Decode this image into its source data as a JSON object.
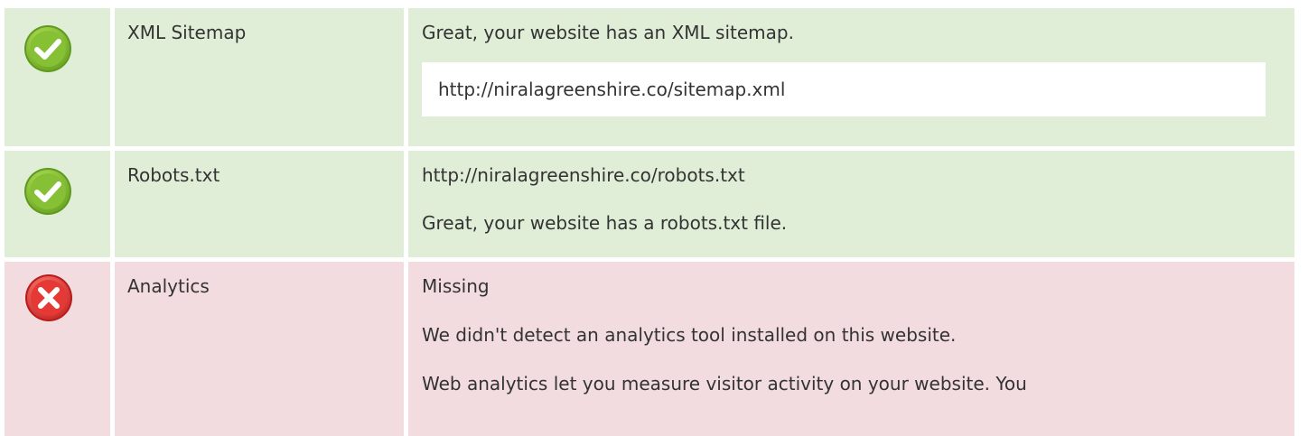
{
  "colors": {
    "pass_bg": "#e0eed8",
    "fail_bg": "#f3dcdf",
    "pass_icon": "#8cc63f",
    "fail_icon": "#e53935"
  },
  "rows": [
    {
      "name": "XML Sitemap",
      "status": "pass",
      "icon": "check-circle-icon",
      "message": "Great, your website has an XML sitemap.",
      "url": "http://niralagreenshire.co/sitemap.xml"
    },
    {
      "name": "Robots.txt",
      "status": "pass",
      "icon": "check-circle-icon",
      "url": "http://niralagreenshire.co/robots.txt",
      "message": "Great, your website has a robots.txt file."
    },
    {
      "name": "Analytics",
      "status": "fail",
      "icon": "cross-circle-icon",
      "result": "Missing",
      "message": "We didn't detect an analytics tool installed on this website.",
      "description": "Web analytics let you measure visitor activity on your website. You"
    }
  ]
}
